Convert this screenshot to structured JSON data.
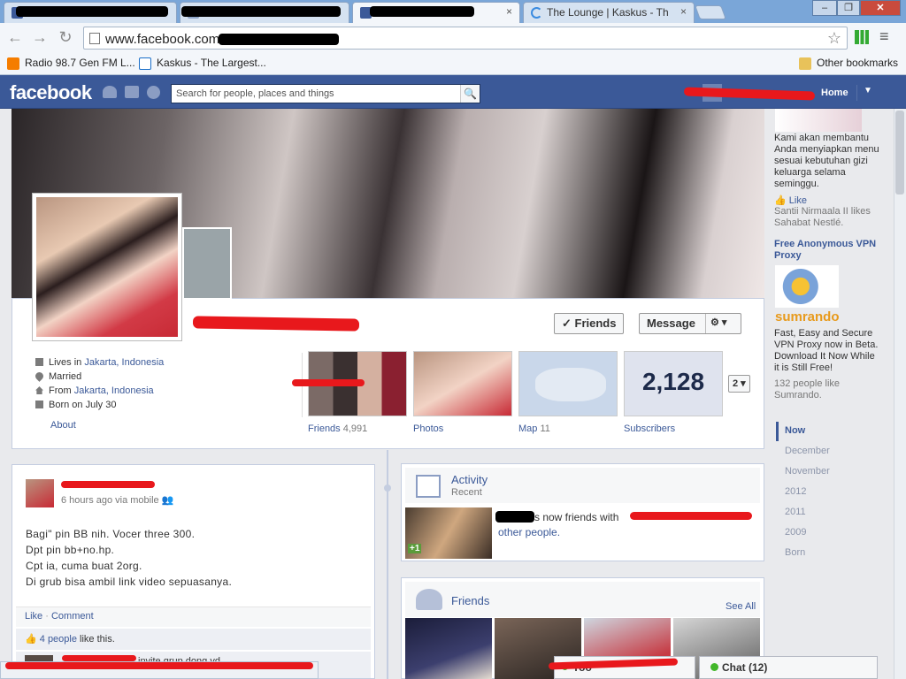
{
  "browser": {
    "tabs": [
      {
        "label": "",
        "active": false
      },
      {
        "label": "",
        "active": false
      },
      {
        "label": "",
        "active": true
      },
      {
        "label": "The Lounge | Kaskus - Th",
        "active": false
      }
    ],
    "url": "www.facebook.com",
    "bookmarks": [
      {
        "label": "Radio 98.7 Gen FM L...",
        "icon": "blogger-icon"
      },
      {
        "label": "Kaskus - The Largest...",
        "icon": "kaskus-icon"
      }
    ],
    "other_bookmarks": "Other bookmarks"
  },
  "fb": {
    "logo": "facebook",
    "search_placeholder": "Search for people, places and things",
    "home": "Home"
  },
  "profile": {
    "actions": {
      "friends": "✓ Friends",
      "message": "Message",
      "gear": "⚙ ▾"
    },
    "info": [
      {
        "icon": "work-icon",
        "prefix": "Lives in ",
        "link": "Jakarta, Indonesia"
      },
      {
        "icon": "heart-icon",
        "prefix": "Married",
        "link": ""
      },
      {
        "icon": "home-icon",
        "prefix": "From ",
        "link": "Jakarta, Indonesia"
      },
      {
        "icon": "birthday-icon",
        "prefix": "Born on July 30",
        "link": ""
      }
    ],
    "about": "About",
    "tiles": [
      {
        "label": "Friends",
        "count": "4,991"
      },
      {
        "label": "Photos",
        "count": ""
      },
      {
        "label": "Map",
        "count": "11"
      },
      {
        "label": "Subscribers",
        "count": ""
      }
    ],
    "subscribers_count": "2,128",
    "more_tiles": "2"
  },
  "post": {
    "meta": "6 hours ago via mobile",
    "lines": [
      "Bagi\" pin BB nih. Vocer three 300.",
      "Dpt pin bb+no.hp.",
      "Cpt ia, cuma buat 2org.",
      "Di grub bisa ambil link video sepuasanya."
    ],
    "like": "Like",
    "sep": " · ",
    "comment": "Comment",
    "likes_link": "4 people",
    "likes_suffix": " like this.",
    "comment_snip": "invite grup dong yd"
  },
  "activity": {
    "title": "Activity",
    "subtitle": "Recent",
    "text_mid": "s now friends with",
    "text_end": "other people.",
    "badge": "+1"
  },
  "friends_box": {
    "title": "Friends",
    "see_all": "See All"
  },
  "sidebar": {
    "ad1_text": "Kami akan membantu Anda menyiapkan menu sesuai kebutuhan gizi keluarga selama seminggu.",
    "ad1_like": "Like",
    "ad1_social": "Santii Nirmaala II likes Sahabat Nestlé.",
    "ad2_title": "Free Anonymous VPN Proxy",
    "ad2_brand": "sumrando",
    "ad2_text": "Fast, Easy and Secure VPN Proxy now in Beta. Download It Now While it is Still Free!",
    "ad2_social": "132 people like Sumrando."
  },
  "years": [
    "Now",
    "December",
    "November",
    "2012",
    "2011",
    "2009",
    "Born"
  ],
  "chat": {
    "label": "Chat (12)",
    "pill": "Yoo"
  },
  "status_text": ""
}
